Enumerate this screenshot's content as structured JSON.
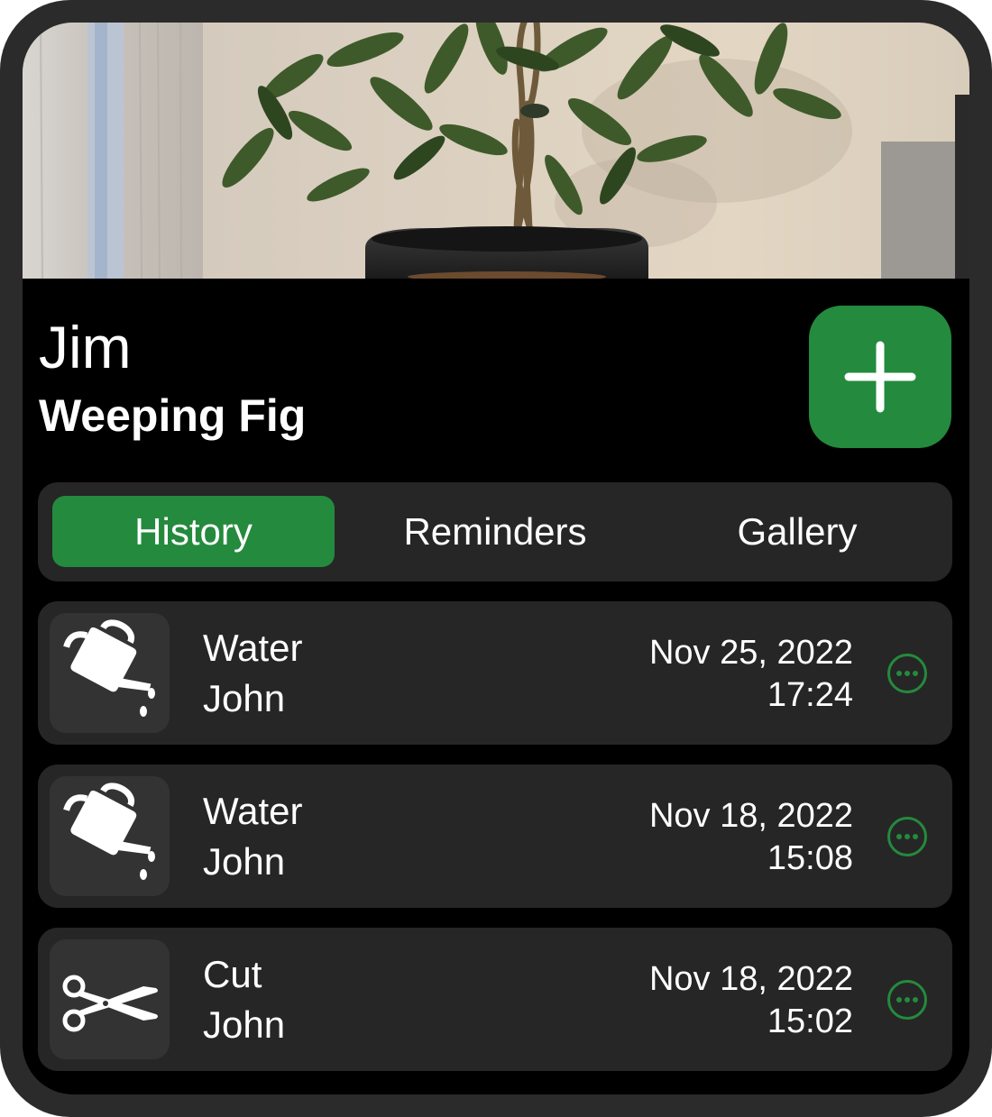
{
  "plant": {
    "name": "Jim",
    "species": "Weeping Fig"
  },
  "colors": {
    "accent": "#248a3d",
    "background": "#000000",
    "card": "#262626",
    "icon_tile": "#333333",
    "text": "#ffffff"
  },
  "add_button": {
    "icon": "plus-icon"
  },
  "tabs": [
    {
      "label": "History",
      "selected": true
    },
    {
      "label": "Reminders",
      "selected": false
    },
    {
      "label": "Gallery",
      "selected": false
    }
  ],
  "history": [
    {
      "icon": "watering-can-icon",
      "action": "Water",
      "person": "John",
      "date": "Nov 25, 2022",
      "time": "17:24",
      "more_icon": "ellipsis-circle-icon"
    },
    {
      "icon": "watering-can-icon",
      "action": "Water",
      "person": "John",
      "date": "Nov 18, 2022",
      "time": "15:08",
      "more_icon": "ellipsis-circle-icon"
    },
    {
      "icon": "scissors-icon",
      "action": "Cut",
      "person": "John",
      "date": "Nov 18, 2022",
      "time": "15:02",
      "more_icon": "ellipsis-circle-icon"
    }
  ]
}
